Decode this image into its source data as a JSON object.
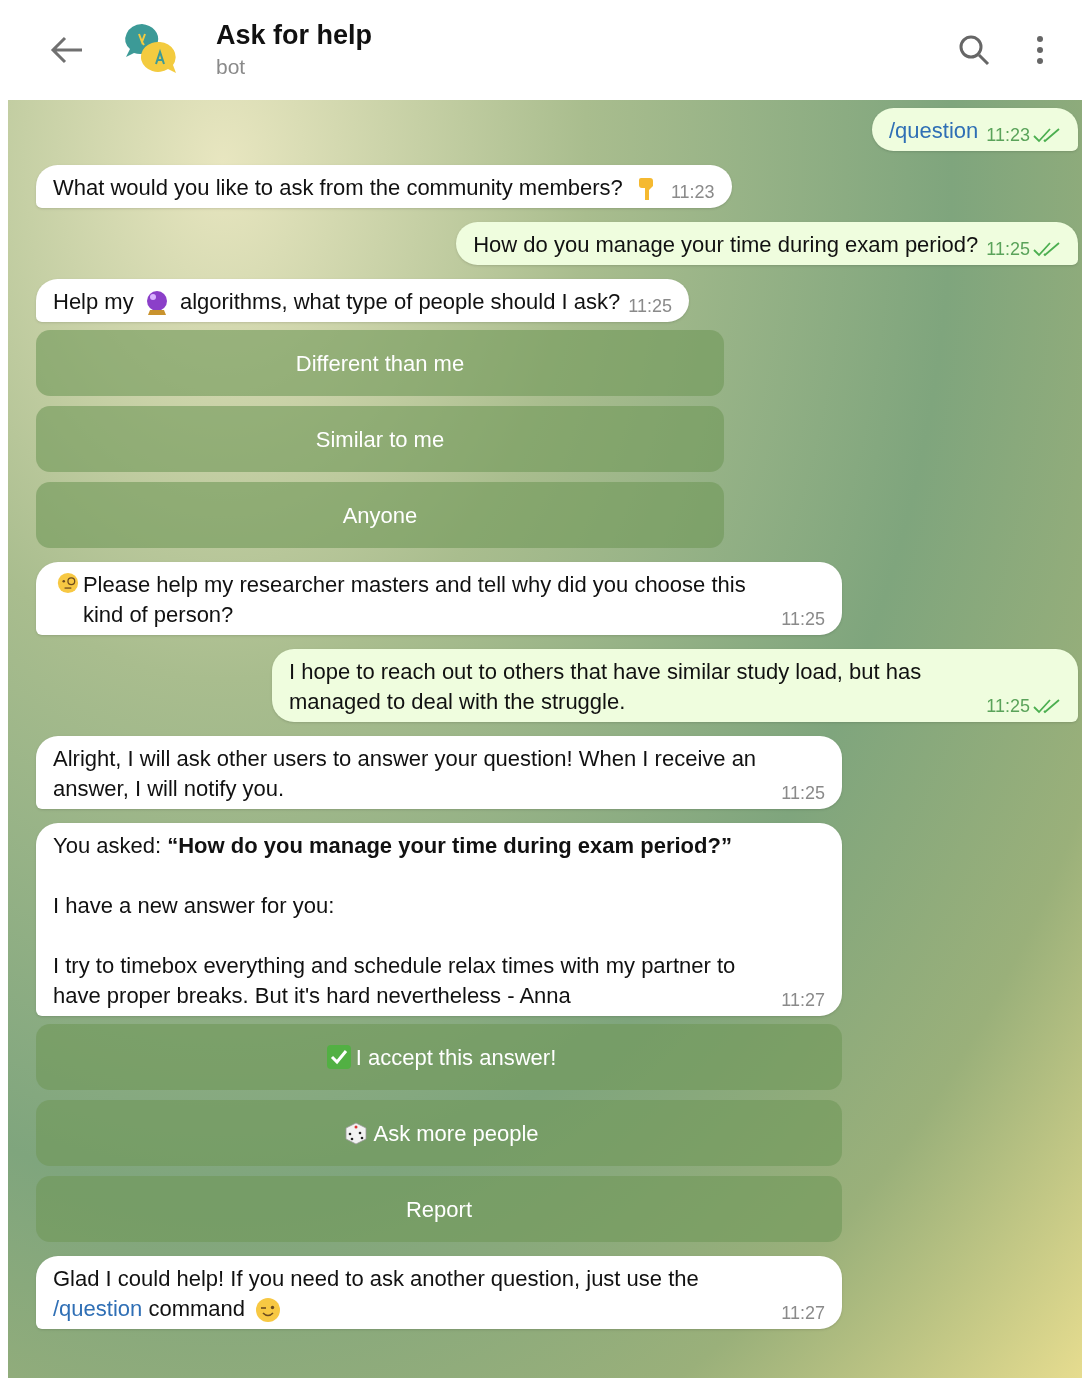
{
  "header": {
    "title": "Ask for help",
    "subtitle": "bot"
  },
  "messages": [
    {
      "kind": "out",
      "time": "11:23",
      "read": true,
      "paragraphs": [
        [
          {
            "kind": "link",
            "text": "/question"
          }
        ]
      ]
    },
    {
      "kind": "in",
      "time": "11:23",
      "paragraphs": [
        [
          {
            "kind": "text",
            "text": "What would you like to ask from the community members?"
          },
          {
            "kind": "hand"
          }
        ]
      ]
    },
    {
      "kind": "out",
      "time": "11:25",
      "read": true,
      "paragraphs": [
        [
          {
            "kind": "text",
            "text": "How do you manage your time during exam period?"
          }
        ]
      ]
    },
    {
      "kind": "in",
      "time": "11:25",
      "paragraphs": [
        [
          {
            "kind": "text",
            "text": "Help my"
          },
          {
            "kind": "ball"
          },
          {
            "kind": "text",
            "text": "algorithms, what type of people should I ask?"
          }
        ]
      ],
      "buttons": [
        {
          "label": "Different than me"
        },
        {
          "label": "Similar to me"
        },
        {
          "label": "Anyone"
        }
      ]
    },
    {
      "kind": "in",
      "time": "11:25",
      "paragraphs": [
        [
          {
            "kind": "monocle"
          },
          {
            "kind": "text",
            "text": "Please help my researcher masters and tell why did you choose this kind of person?"
          }
        ]
      ]
    },
    {
      "kind": "out",
      "time": "11:25",
      "read": true,
      "paragraphs": [
        [
          {
            "kind": "text",
            "text": "I hope to reach out to others that have similar study load, but has managed to deal with the struggle."
          }
        ]
      ]
    },
    {
      "kind": "in",
      "time": "11:25",
      "paragraphs": [
        [
          {
            "kind": "text",
            "text": "Alright, I will ask other users to answer your question! When I receive an answer, I will notify you."
          }
        ]
      ]
    },
    {
      "kind": "in",
      "time": "11:27",
      "paragraphs": [
        [
          {
            "kind": "text",
            "text": "You asked: **“How do you manage your time during exam period?”**"
          }
        ],
        [
          {
            "kind": "text",
            "text": "I have a new answer for you:"
          }
        ],
        [
          {
            "kind": "text",
            "text": "I try to timebox everything and schedule relax times with my partner to have proper breaks. But it's hard nevertheless - Anna"
          }
        ]
      ],
      "buttons": [
        {
          "label": "I accept this answer!",
          "kind": "check"
        },
        {
          "label": "Ask more people",
          "kind": "dice"
        },
        {
          "label": "Report"
        }
      ]
    },
    {
      "kind": "in",
      "time": "11:27",
      "paragraphs": [
        [
          {
            "kind": "text",
            "text": "Glad I could help! If you need to ask another question, just use the"
          },
          {
            "kind": "link",
            "text": "/question"
          },
          {
            "kind": "text",
            "text": "command"
          },
          {
            "kind": "wink"
          }
        ]
      ]
    }
  ]
}
